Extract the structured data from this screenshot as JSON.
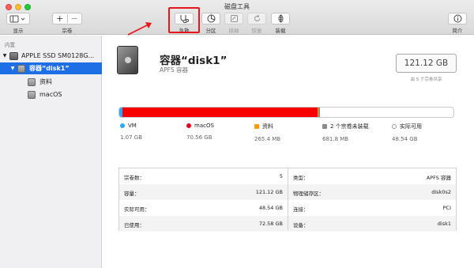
{
  "window": {
    "title": "磁盘工具"
  },
  "toolbar": {
    "view_label": "显示",
    "volume_label": "宗卷",
    "rescue_label": "急救",
    "partition_label": "分区",
    "erase_label": "抹掉",
    "restore_label": "恢复",
    "mount_label": "装载",
    "info_label": "简介"
  },
  "sidebar": {
    "section": "内置",
    "items": [
      {
        "label": "APPLE SSD SM0128G..."
      },
      {
        "label": "容器“disk1”"
      },
      {
        "label": "资料"
      },
      {
        "label": "macOS"
      }
    ]
  },
  "main": {
    "disk_name": "容器“disk1”",
    "disk_sub": "APFS 容器",
    "capacity": "121.12 GB",
    "capacity_note": "由 5 个宗卷共享"
  },
  "usage": {
    "segments": [
      {
        "fraction": 0.009,
        "color": "#2aa8ff"
      },
      {
        "fraction": 0.583,
        "color": "#f60000"
      },
      {
        "fraction": 0.0022,
        "color": "#ff9900"
      },
      {
        "fraction": 0.0056,
        "color": "#8a8a8a"
      }
    ],
    "legend": [
      {
        "name": "VM",
        "size": "1.07 GB",
        "color": "#2aa8ff"
      },
      {
        "name": "macOS",
        "size": "70.56 GB",
        "color": "#e9001c"
      },
      {
        "name": "资料",
        "size": "265.4 MB",
        "color": "#ff9900"
      },
      {
        "name": "2 个宗卷未装载",
        "size": "681.8 MB",
        "color": "#8a8a8a"
      },
      {
        "name": "实际可用",
        "size": "48.54 GB",
        "color": "#ffffff"
      }
    ]
  },
  "info": {
    "rows": [
      {
        "l_label": "宗卷数：",
        "l_value": "5",
        "r_label": "类型：",
        "r_value": "APFS 容器"
      },
      {
        "l_label": "容量：",
        "l_value": "121.12 GB",
        "r_label": "物理储存区：",
        "r_value": "disk0s2"
      },
      {
        "l_label": "实际可用：",
        "l_value": "48.54 GB",
        "r_label": "连接：",
        "r_value": "PCI"
      },
      {
        "l_label": "已使用：",
        "l_value": "72.58 GB",
        "r_label": "设备：",
        "r_value": "disk1"
      }
    ]
  },
  "colors": {
    "accent": "#1e6fe6",
    "highlight": "#e8141b"
  },
  "icons": [
    "sidebar-toggle-icon",
    "plus-icon",
    "minus-icon",
    "stethoscope-icon",
    "pie-icon",
    "erase-icon",
    "restore-icon",
    "mount-icon",
    "info-icon"
  ]
}
